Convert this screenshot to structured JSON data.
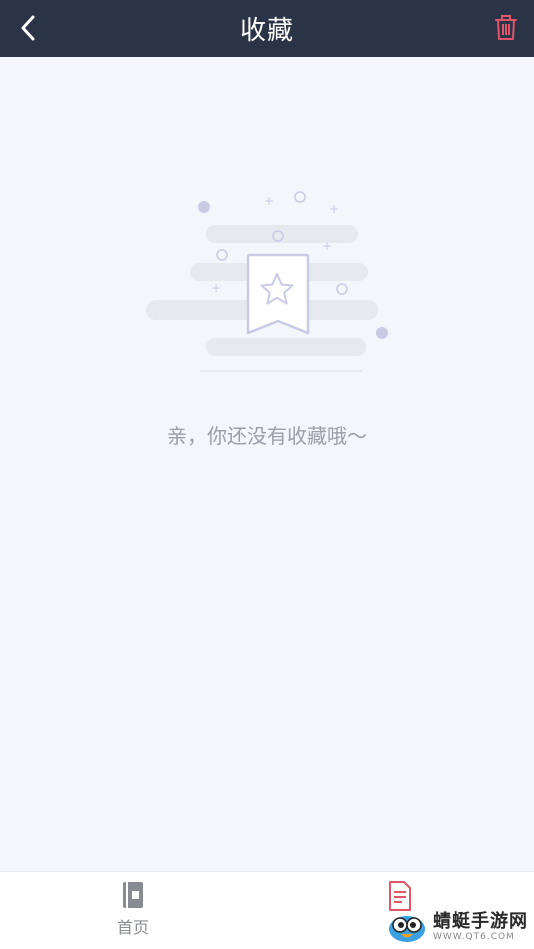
{
  "header": {
    "title": "收藏",
    "back_icon": "chevron-left-icon",
    "delete_icon": "trash-icon",
    "delete_color": "#e0556a",
    "background": "#2b3446"
  },
  "empty_state": {
    "illustration_icon": "bookmark-star-icon",
    "message": "亲，你还没有收藏哦～"
  },
  "tabbar": {
    "tabs": [
      {
        "label": "首页",
        "icon": "book-icon",
        "active": false
      },
      {
        "label": "",
        "icon": "document-icon",
        "active": true
      }
    ],
    "active_color": "#e0556a",
    "inactive_color": "#888c92"
  },
  "watermark": {
    "name": "蜻蜓手游网",
    "url": "WWW.QT6.COM"
  }
}
